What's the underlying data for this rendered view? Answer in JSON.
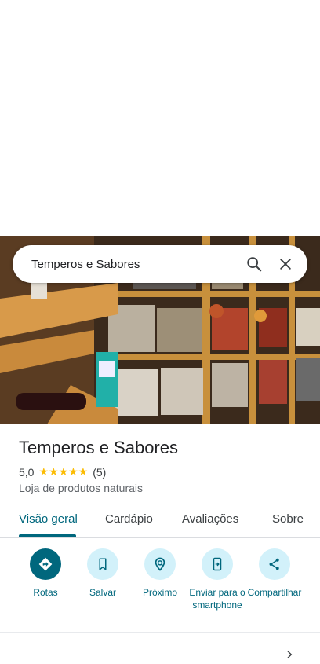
{
  "search": {
    "query": "Temperos e Sabores"
  },
  "place": {
    "name": "Temperos e Sabores",
    "rating": "5,0",
    "stars": "★★★★★",
    "review_count": "(5)",
    "category": "Loja de produtos naturais"
  },
  "tabs": [
    {
      "label": "Visão geral",
      "active": true
    },
    {
      "label": "Cardápio"
    },
    {
      "label": "Avaliações"
    },
    {
      "label": "Sobre"
    }
  ],
  "actions": [
    {
      "label": "Rotas",
      "icon": "directions-icon"
    },
    {
      "label": "Salvar",
      "icon": "bookmark-icon"
    },
    {
      "label": "Próximo",
      "icon": "nearby-icon"
    },
    {
      "label": "Enviar para o smartphone",
      "icon": "send-to-phone-icon"
    },
    {
      "label": "Compartilhar",
      "icon": "share-icon"
    }
  ],
  "colors": {
    "accent": "#00677d",
    "chip_bg": "#d2f1fa",
    "star": "#fbbc04"
  }
}
